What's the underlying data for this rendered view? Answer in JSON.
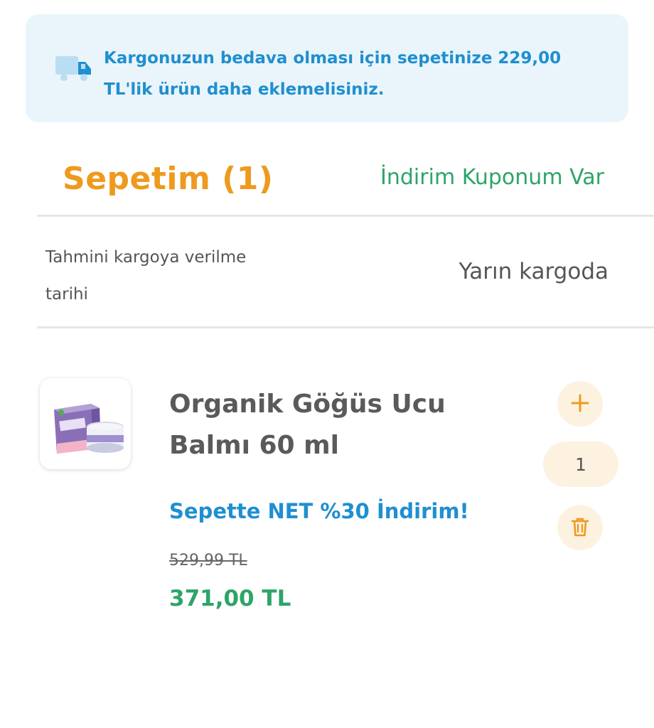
{
  "banner": {
    "icon": "truck-icon",
    "message": "Kargonuzun bedava olması için sepetinize 229,00 TL'lik ürün daha eklemelisiniz."
  },
  "header": {
    "title": "Sepetim (1)",
    "coupon_link": "İndirim Kuponum Var"
  },
  "shipping": {
    "label": "Tahmini kargoya verilme tarihi",
    "value": "Yarın kargoda"
  },
  "product": {
    "name": "Organik Göğüs Ucu Balmı 60 ml",
    "promo": "Sepette NET %30 İndirim!",
    "old_price": "529,99 TL",
    "new_price": "371,00 TL",
    "quantity": "1",
    "image_icon": "product-box-jar-image"
  },
  "controls": {
    "increase_icon": "plus-icon",
    "delete_icon": "trash-icon"
  },
  "colors": {
    "accent_orange": "#ee9a1e",
    "accent_green": "#2ea468",
    "accent_blue": "#1f8fd0",
    "banner_bg": "#eaf5fb",
    "control_bg": "#fdf2e0"
  }
}
